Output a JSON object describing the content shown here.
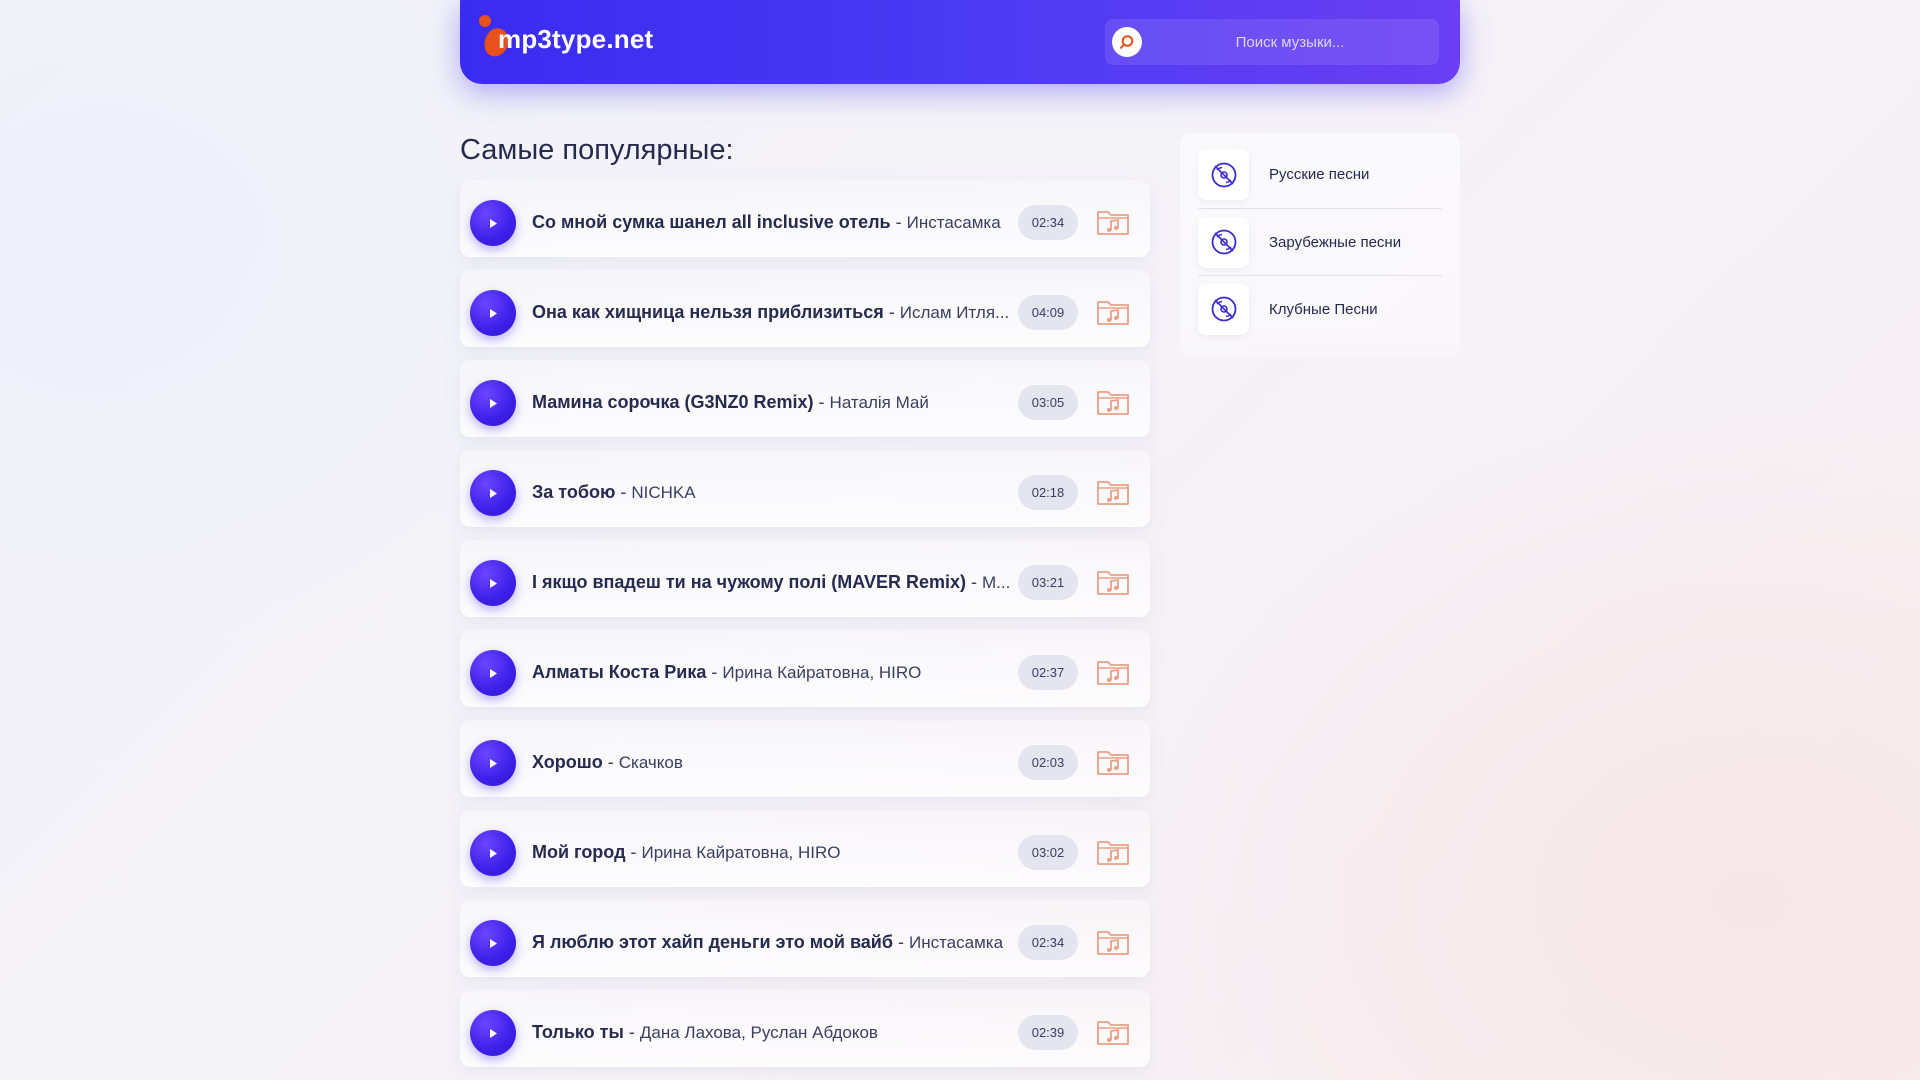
{
  "header": {
    "logo_text": "mp3type.net",
    "search_placeholder": "Поиск музыки..."
  },
  "main": {
    "section_title": "Самые популярные:",
    "tracks": [
      {
        "title": "Со мной сумка шанел all inclusive отель",
        "artist": "Инстасамка",
        "duration": "02:34"
      },
      {
        "title": "Она как хищница нельзя приблизиться",
        "artist": "Ислам Итля...",
        "duration": "04:09"
      },
      {
        "title": "Мамина сорочка (G3NZ0 Remix)",
        "artist": "Наталія Май",
        "duration": "03:05"
      },
      {
        "title": "За тобою",
        "artist": "NICHKA",
        "duration": "02:18"
      },
      {
        "title": "І якщо впадеш ти на чужому полі (MAVER Remix)",
        "artist": "M...",
        "duration": "03:21"
      },
      {
        "title": "Алматы Коста Рика",
        "artist": "Ирина Кайратовна, HIRO",
        "duration": "02:37"
      },
      {
        "title": "Хорошо",
        "artist": "Скачков",
        "duration": "02:03"
      },
      {
        "title": "Мой город",
        "artist": "Ирина Кайратовна, HIRO",
        "duration": "03:02"
      },
      {
        "title": "Я люблю этот хайп деньги это мой вайб",
        "artist": "Инстасамка",
        "duration": "02:34"
      },
      {
        "title": "Только ты",
        "artist": "Дана Лахова, Руслан Абдоков",
        "duration": "02:39"
      }
    ],
    "separator": " - "
  },
  "sidebar": {
    "items": [
      {
        "label": "Русские песни",
        "icon": "vinyl-record-icon"
      },
      {
        "label": "Зарубежные песни",
        "icon": "vinyl-record-icon"
      },
      {
        "label": "Клубные Песни",
        "icon": "vinyl-record-icon"
      }
    ]
  },
  "colors": {
    "header_gradient_start": "#3a2bf0",
    "header_gradient_end": "#6a3ff3",
    "play_button": "#3d1fe8",
    "download_icon": "#e8a086",
    "logo_accent": "#e8501c",
    "text_primary": "#262a4f"
  }
}
